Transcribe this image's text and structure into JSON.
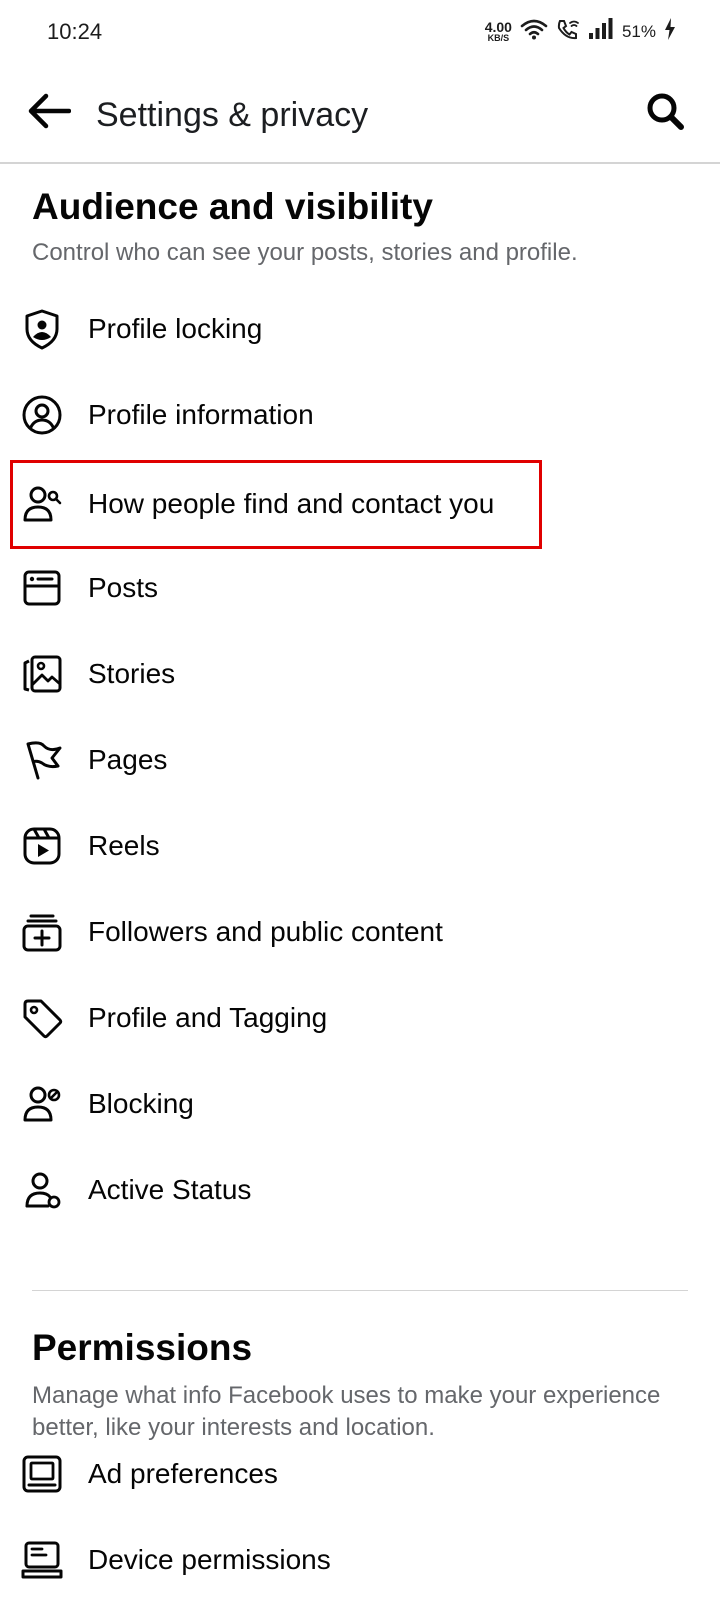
{
  "status_bar": {
    "time": "10:24",
    "net_speed_value": "4.00",
    "net_speed_unit": "KB/S",
    "battery": "51%",
    "icons": [
      "wifi-icon",
      "wifi-call-icon",
      "signal-icon",
      "charging-icon"
    ]
  },
  "app_bar": {
    "title": "Settings & privacy",
    "back_icon": "back-arrow-icon",
    "search_icon": "search-icon"
  },
  "audience": {
    "title": "Audience and visibility",
    "description": "Control who can see your posts, stories and profile.",
    "items": [
      {
        "label": "Profile locking",
        "icon": "profile-lock-icon"
      },
      {
        "label": "Profile information",
        "icon": "profile-circle-icon"
      },
      {
        "label": "How people find and contact you",
        "icon": "find-people-icon",
        "highlighted": true
      },
      {
        "label": "Posts",
        "icon": "posts-icon"
      },
      {
        "label": "Stories",
        "icon": "stories-icon"
      },
      {
        "label": "Pages",
        "icon": "flag-icon"
      },
      {
        "label": "Reels",
        "icon": "reels-icon"
      },
      {
        "label": "Followers and public content",
        "icon": "followers-icon"
      },
      {
        "label": "Profile and Tagging",
        "icon": "tag-icon"
      },
      {
        "label": "Blocking",
        "icon": "block-user-icon"
      },
      {
        "label": "Active Status",
        "icon": "active-status-icon"
      }
    ]
  },
  "permissions": {
    "title": "Permissions",
    "description": "Manage what info Facebook uses to make your experience better, like your interests and location.",
    "items": [
      {
        "label": "Ad preferences",
        "icon": "ad-preferences-icon"
      },
      {
        "label": "Device permissions",
        "icon": "device-permissions-icon"
      }
    ]
  },
  "colors": {
    "text_primary": "#050505",
    "text_secondary": "#65676b",
    "highlight": "#e00000",
    "divider": "#d4d4d4"
  }
}
